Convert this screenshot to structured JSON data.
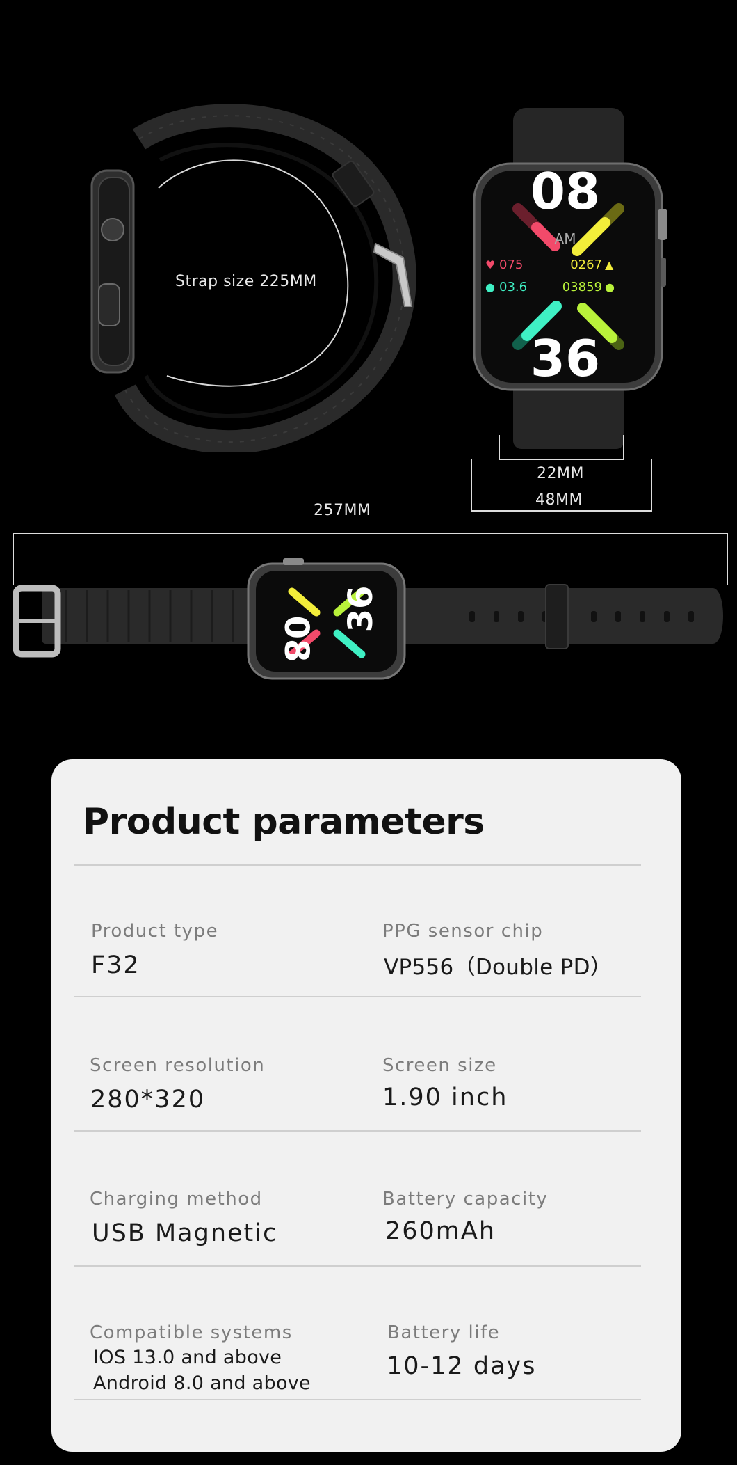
{
  "dimensions": {
    "strap_size": "Strap size 225MM",
    "lug_width": "22MM",
    "case_width": "48MM",
    "total_length": "257MM"
  },
  "watch_face": {
    "hour": "08",
    "minute": "36",
    "ampm": "AM",
    "heart_rate": "075",
    "spo2": "03.6",
    "calories": "0267",
    "steps": "03859"
  },
  "card": {
    "title": "Product parameters",
    "params": [
      {
        "label": "Product type",
        "value": "F32"
      },
      {
        "label": "PPG sensor chip",
        "value": "VP556（Double PD）"
      },
      {
        "label": "Screen resolution",
        "value": "280*320"
      },
      {
        "label": "Screen size",
        "value": "1.90 inch"
      },
      {
        "label": "Charging method",
        "value": "USB Magnetic"
      },
      {
        "label": "Battery capacity",
        "value": "260mAh"
      },
      {
        "label": "Compatible systems",
        "value_lines": [
          "IOS 13.0 and above",
          "Android  8.0 and above"
        ]
      },
      {
        "label": "Battery life",
        "value": "10-12 days"
      }
    ]
  },
  "colors": {
    "bar_red": "#f24a6a",
    "bar_yellow": "#f3ee3a",
    "bar_teal": "#3ff0c4",
    "bar_lime": "#b9f23a"
  }
}
